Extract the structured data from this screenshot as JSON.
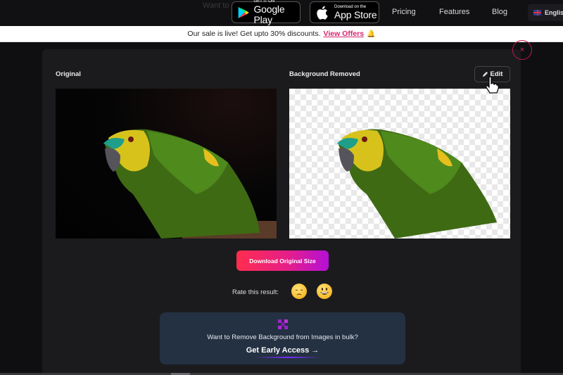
{
  "header": {
    "ghost_text": "Want to",
    "google_play": {
      "small": "GET IT ON",
      "big": "Google Play"
    },
    "app_store": {
      "small": "Download on the",
      "big": "App Store"
    },
    "nav": [
      "Pricing",
      "Features",
      "Blog"
    ],
    "language": "English"
  },
  "banner": {
    "text": "Our sale is live! Get upto 30% discounts.",
    "link": "View Offers",
    "icon": "bell-icon"
  },
  "modal": {
    "close_icon": "×",
    "original_label": "Original",
    "removed_label": "Background Removed",
    "edit_label": "Edit",
    "download_label": "Download Original Size",
    "rate_label": "Rate this result:",
    "rate_options": [
      "sad-emoji",
      "happy-emoji"
    ],
    "bulk": {
      "text": "Want to Remove Background from Images in bulk?",
      "cta": "Get Early Access →"
    }
  },
  "colors": {
    "accent": "#d6246e",
    "download_gradient": [
      "#ff2d4e",
      "#e61f88",
      "#b410d6"
    ],
    "bulk_card": "#243142"
  }
}
